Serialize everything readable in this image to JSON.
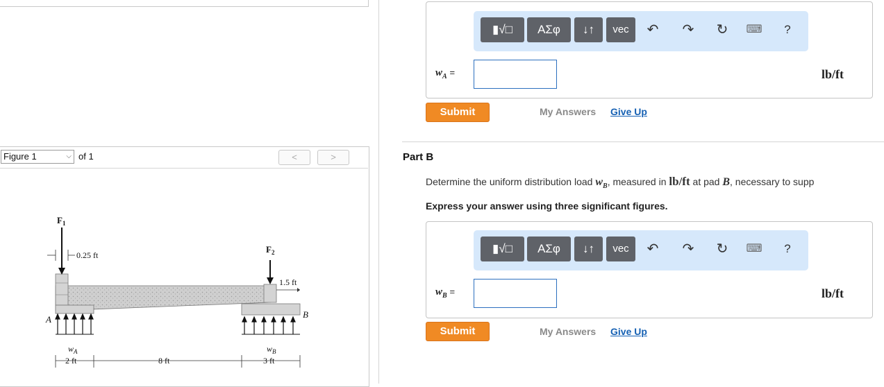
{
  "figure_nav": {
    "select_value": "Figure 1",
    "of_text": "of 1",
    "prev": "<",
    "next": ">"
  },
  "toolbar": {
    "templates_icon": "template-radical-icon",
    "greek_label": "ΑΣφ",
    "arrows_label": "↓↑",
    "vec_label": "vec",
    "undo": "↶",
    "redo": "↷",
    "reset": "↻",
    "keyboard": "⌨",
    "help": "?"
  },
  "part_a": {
    "var_main": "w",
    "var_sub": "A",
    "equals": "=",
    "value": "",
    "unit": "lb/ft",
    "submit_label": "Submit",
    "my_answers": "My Answers",
    "give_up": "Give Up"
  },
  "part_b": {
    "title": "Part B",
    "desc_1": "Determine the uniform distribution load ",
    "desc_var": "w",
    "desc_var_sub": "B",
    "desc_2": ", measured in ",
    "desc_unit": "lb/ft",
    "desc_3": " at pad ",
    "desc_pad": "B",
    "desc_4": ", necessary to supp",
    "express": "Express your answer using three significant figures.",
    "var_main": "w",
    "var_sub": "B",
    "equals": "=",
    "value": "",
    "unit": "lb/ft",
    "submit_label": "Submit",
    "my_answers": "My Answers",
    "give_up": "Give Up"
  },
  "figure": {
    "f1_main": "F",
    "f1_sub": "1",
    "f2_main": "F",
    "f2_sub": "2",
    "dim_025": "0.25 ft",
    "dim_15": "1.5 ft",
    "label_a": "A",
    "label_b": "B",
    "wa_main": "w",
    "wa_sub": "A",
    "wb_main": "w",
    "wb_sub": "B",
    "dim_2": "2 ft",
    "dim_8": "8 ft",
    "dim_3": "3 ft"
  }
}
